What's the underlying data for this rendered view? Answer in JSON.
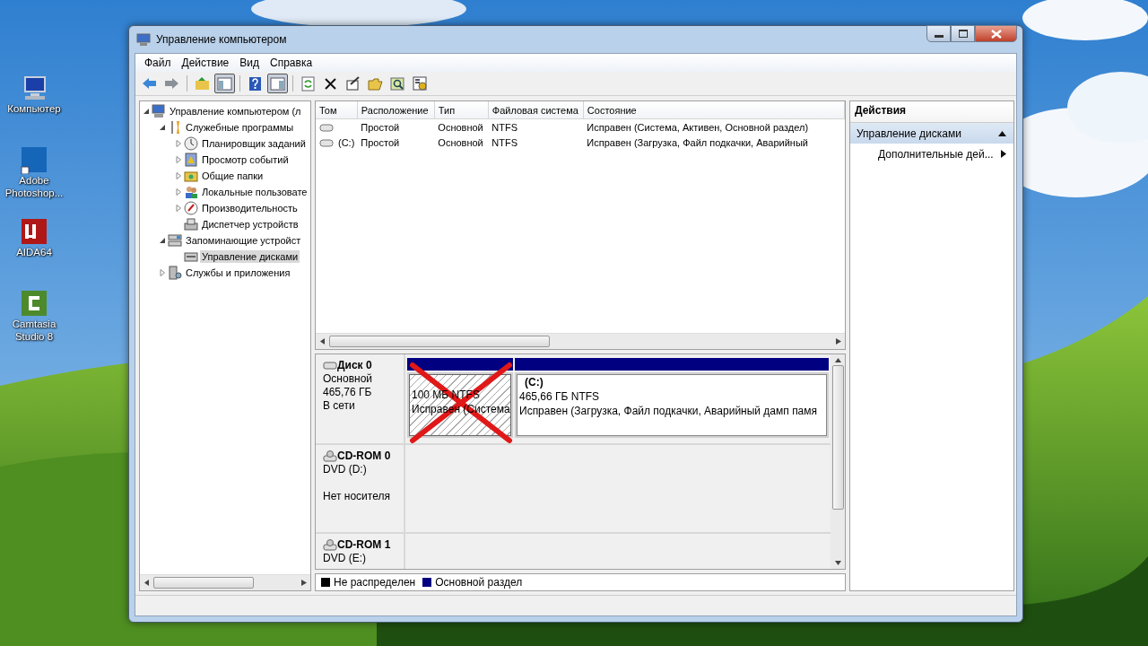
{
  "desktop_icons": [
    {
      "label": "Компьютер",
      "kind": "computer"
    },
    {
      "label": "Adobe Photoshop...",
      "kind": "photoshop"
    },
    {
      "label": "AIDA64",
      "kind": "aida"
    },
    {
      "label": "Camtasia Studio 8",
      "kind": "camtasia"
    }
  ],
  "window": {
    "title": "Управление компьютером"
  },
  "menu": [
    "Файл",
    "Действие",
    "Вид",
    "Справка"
  ],
  "toolbar": [
    [
      {
        "kind": "back",
        "pressed": false
      },
      {
        "kind": "forward",
        "pressed": false
      }
    ],
    [
      {
        "kind": "up",
        "pressed": false
      },
      {
        "kind": "tree",
        "pressed": true
      }
    ],
    [
      {
        "kind": "help",
        "pressed": false
      },
      {
        "kind": "pane",
        "pressed": true
      }
    ],
    [
      {
        "kind": "refresh",
        "pressed": false
      },
      {
        "kind": "delete",
        "pressed": false
      },
      {
        "kind": "properties",
        "pressed": false
      },
      {
        "kind": "open",
        "pressed": false
      },
      {
        "kind": "search",
        "pressed": false
      },
      {
        "kind": "settings",
        "pressed": false
      }
    ]
  ],
  "tree": [
    {
      "label": "Управление компьютером (л",
      "kind": "computer",
      "expanded": true,
      "selected": false,
      "children": [
        {
          "label": "Служебные программы",
          "kind": "tools",
          "expanded": true,
          "selected": false,
          "children": [
            {
              "label": "Планировщик заданий",
              "kind": "clock",
              "expanded": false,
              "selected": false
            },
            {
              "label": "Просмотр событий",
              "kind": "events",
              "expanded": false,
              "selected": false
            },
            {
              "label": "Общие папки",
              "kind": "folders",
              "expanded": false,
              "selected": false
            },
            {
              "label": "Локальные пользовате",
              "kind": "users",
              "expanded": false,
              "selected": false
            },
            {
              "label": "Производительность",
              "kind": "perf",
              "expanded": false,
              "selected": false
            },
            {
              "label": "Диспетчер устройств",
              "kind": "devices",
              "selected": false
            }
          ]
        },
        {
          "label": "Запоминающие устройст",
          "kind": "storage",
          "expanded": true,
          "selected": false,
          "children": [
            {
              "label": "Управление дисками",
              "kind": "diskmgmt",
              "selected": true
            }
          ]
        },
        {
          "label": "Службы и приложения",
          "kind": "services",
          "expanded": false,
          "selected": false
        }
      ]
    }
  ],
  "volumes": {
    "columns": [
      "Том",
      "Расположение",
      "Тип",
      "Файловая система",
      "Состояние"
    ],
    "rows": [
      {
        "cells": [
          "",
          "Простой",
          "Основной",
          "NTFS",
          "Исправен (Система, Активен, Основной раздел)"
        ]
      },
      {
        "cells": [
          "(C:)",
          "Простой",
          "Основной",
          "NTFS",
          "Исправен (Загрузка, Файл подкачки, Аварийный"
        ]
      }
    ]
  },
  "disks": [
    {
      "kind": "disk",
      "name": "Диск 0",
      "lines": [
        "Основной",
        "465,76 ГБ",
        "В сети"
      ],
      "partitions": [
        {
          "size": "100 МБ NTFS",
          "status": "Исправен (Система",
          "selected": true,
          "color": "#000080"
        },
        {
          "name": "(C:)",
          "size": "465,66 ГБ NTFS",
          "status": "Исправен (Загрузка, Файл подкачки, Аварийный дамп памя",
          "selected": false,
          "color": "#000080"
        }
      ]
    },
    {
      "kind": "cdrom",
      "name": "CD-ROM 0",
      "lines": [
        "DVD (D:)"
      ],
      "media": "Нет носителя"
    },
    {
      "kind": "cdrom",
      "name": "CD-ROM 1",
      "lines": [
        "DVD (E:)"
      ]
    }
  ],
  "legend": [
    {
      "label": "Не распределен",
      "color": "#000000"
    },
    {
      "label": "Основной раздел",
      "color": "#000080"
    }
  ],
  "actions": {
    "title": "Действия",
    "section": "Управление дисками",
    "expanded": true,
    "items": [
      "Дополнительные дей..."
    ]
  }
}
